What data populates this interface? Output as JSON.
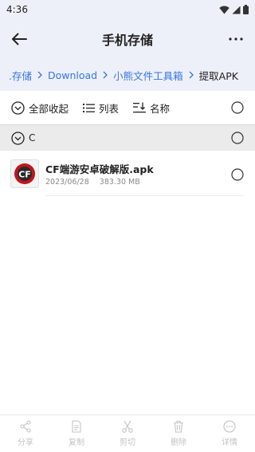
{
  "status_bar": {
    "time": "4:36"
  },
  "app_bar": {
    "title": "手机存储"
  },
  "breadcrumb": {
    "items": [
      ".存储",
      "Download",
      "小熊文件工具箱"
    ],
    "current": "提取APK"
  },
  "toolbar": {
    "collapse_all": "全部收起",
    "list_view": "列表",
    "sort_by_name": "名称"
  },
  "group": {
    "label": "C"
  },
  "files": [
    {
      "name": "CF端游安卓破解版.apk",
      "date": "2023/06/28",
      "size": "383.30 MB"
    }
  ],
  "bottom_bar": {
    "share": "分享",
    "copy": "复制",
    "cut": "剪切",
    "delete": "删除",
    "details": "详情"
  },
  "colors": {
    "accent": "#3476e4",
    "header_bg": "#eef0f9",
    "disabled": "#c3c3c3"
  }
}
